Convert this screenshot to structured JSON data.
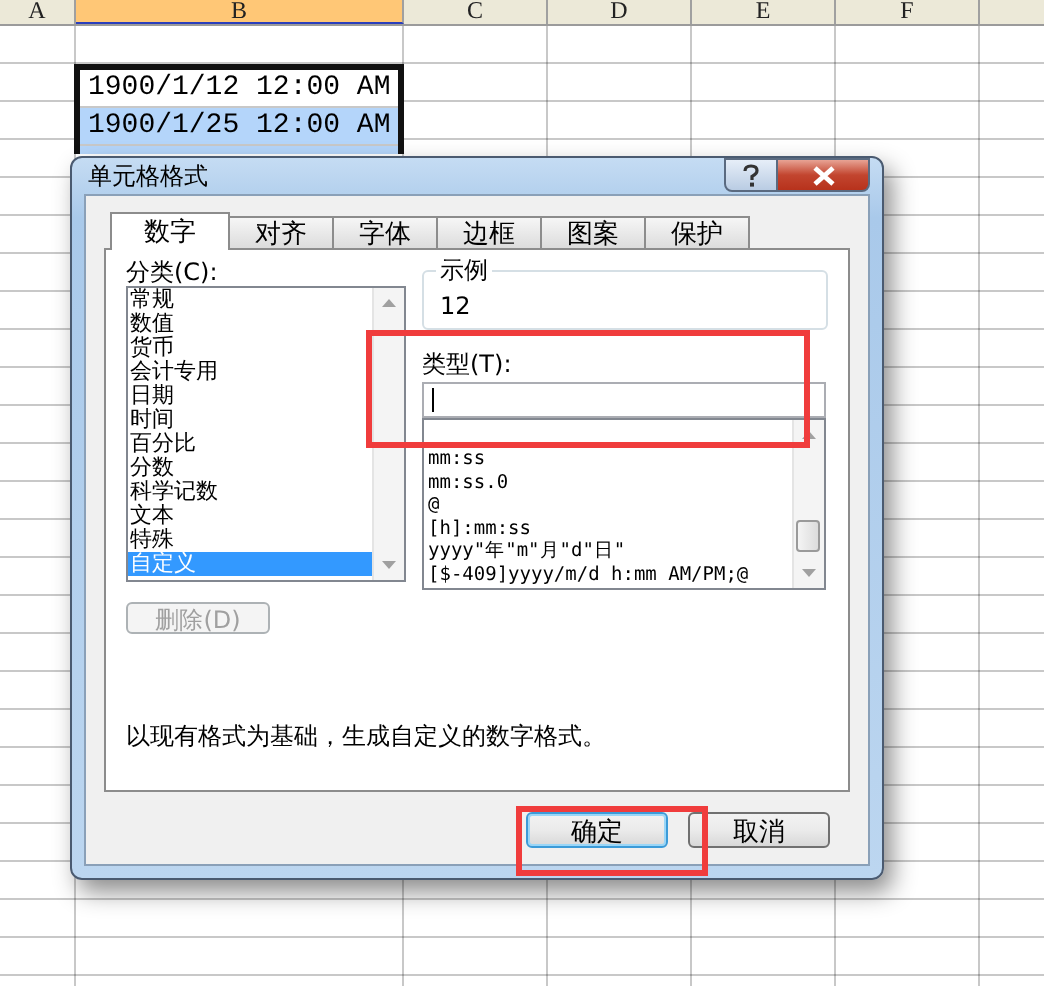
{
  "sheet": {
    "columns": [
      {
        "label": "A",
        "selected": false
      },
      {
        "label": "B",
        "selected": true
      },
      {
        "label": "C",
        "selected": false
      },
      {
        "label": "D",
        "selected": false
      },
      {
        "label": "E",
        "selected": false
      },
      {
        "label": "F",
        "selected": false
      }
    ],
    "cells": [
      {
        "text": "1900/1/12 12:00 AM",
        "selected": false
      },
      {
        "text": "1900/1/25 12:00 AM",
        "selected": true
      }
    ]
  },
  "dialog": {
    "title": "单元格格式",
    "tabs": [
      {
        "label": "数字",
        "selected": true
      },
      {
        "label": "对齐",
        "selected": false
      },
      {
        "label": "字体",
        "selected": false
      },
      {
        "label": "边框",
        "selected": false
      },
      {
        "label": "图案",
        "selected": false
      },
      {
        "label": "保护",
        "selected": false
      }
    ],
    "category_label": "分类(C):",
    "categories": [
      {
        "label": "常规",
        "selected": false
      },
      {
        "label": "数值",
        "selected": false
      },
      {
        "label": "货币",
        "selected": false
      },
      {
        "label": "会计专用",
        "selected": false
      },
      {
        "label": "日期",
        "selected": false
      },
      {
        "label": "时间",
        "selected": false
      },
      {
        "label": "百分比",
        "selected": false
      },
      {
        "label": "分数",
        "selected": false
      },
      {
        "label": "科学记数",
        "selected": false
      },
      {
        "label": "文本",
        "selected": false
      },
      {
        "label": "特殊",
        "selected": false
      },
      {
        "label": "自定义",
        "selected": true
      }
    ],
    "delete_button": {
      "label": "删除(D)",
      "disabled": true
    },
    "sample": {
      "label": "示例",
      "value": "12"
    },
    "type_label": "类型(T):",
    "formats": [
      "mm:ss",
      "mm:ss.0",
      "@",
      "[h]:mm:ss",
      "yyyy\"年\"m\"月\"d\"日\"",
      "[$-409]yyyy/m/d h:mm AM/PM;@"
    ],
    "description": "以现有格式为基础，生成自定义的数字格式。",
    "buttons": [
      {
        "label": "确定",
        "default": true
      },
      {
        "label": "取消",
        "default": false
      }
    ]
  }
}
